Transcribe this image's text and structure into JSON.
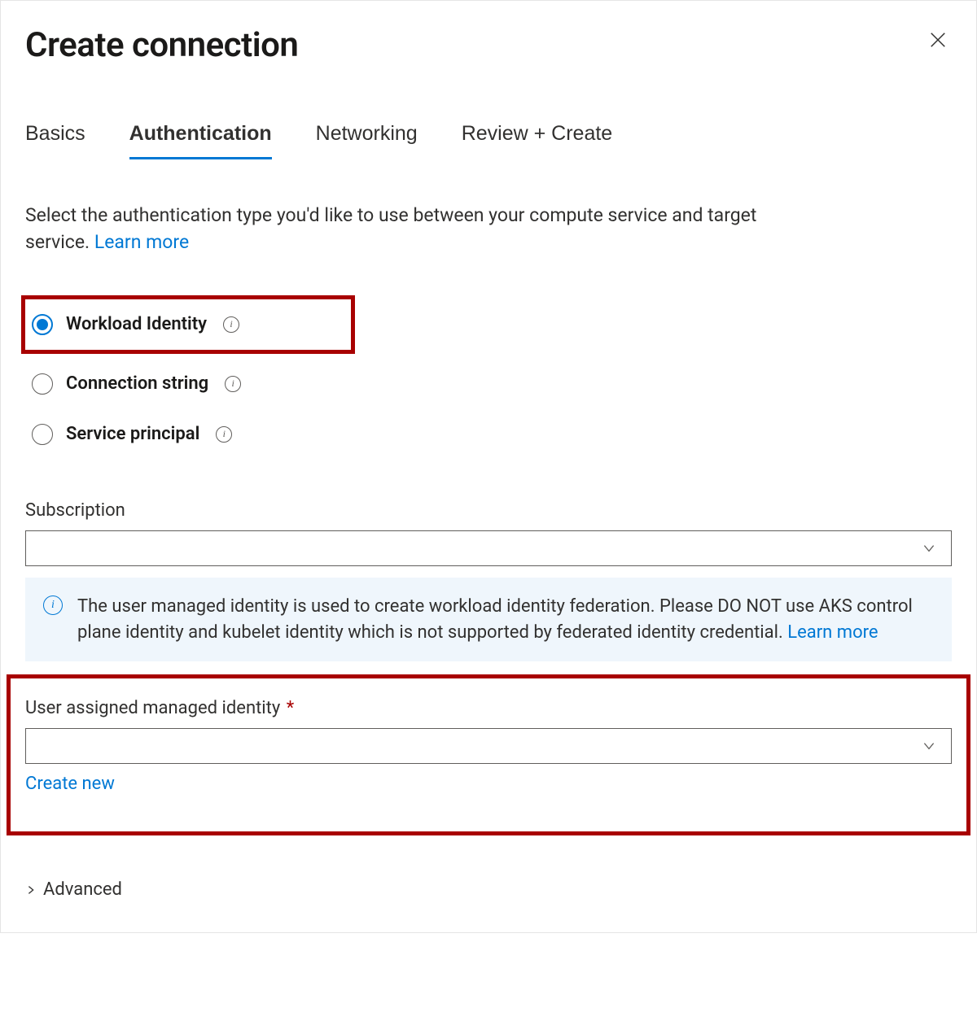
{
  "header": {
    "title": "Create connection"
  },
  "tabs": [
    {
      "label": "Basics",
      "active": false
    },
    {
      "label": "Authentication",
      "active": true
    },
    {
      "label": "Networking",
      "active": false
    },
    {
      "label": "Review + Create",
      "active": false
    }
  ],
  "description_text": "Select the authentication type you'd like to use between your compute service and target service. ",
  "description_link": "Learn more",
  "auth_options": [
    {
      "label": "Workload Identity",
      "selected": true,
      "highlighted": true
    },
    {
      "label": "Connection string",
      "selected": false,
      "highlighted": false
    },
    {
      "label": "Service principal",
      "selected": false,
      "highlighted": false
    }
  ],
  "subscription": {
    "label": "Subscription",
    "value": ""
  },
  "info_callout": {
    "text": "The user managed identity is used to create workload identity federation. Please DO NOT use AKS control plane identity and kubelet identity which is not supported by federated identity credential.  ",
    "link": "Learn more"
  },
  "uami": {
    "label": "User assigned managed identity",
    "required_marker": "*",
    "value": "",
    "create_new_label": "Create new"
  },
  "advanced_label": "Advanced",
  "icons": {
    "info_glyph": "i"
  }
}
